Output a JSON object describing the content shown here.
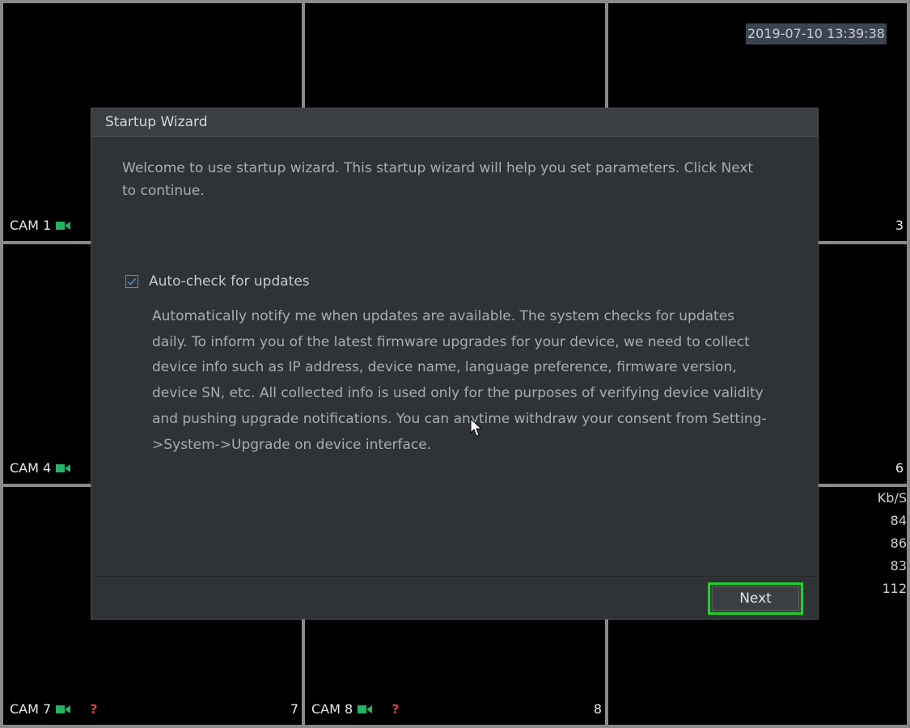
{
  "overlay": {
    "timestamp": "2019-07-10 13:39:38",
    "bitrate_header": "Kb/S",
    "bitrates": [
      "84",
      "86",
      "83",
      "112"
    ]
  },
  "cameras": {
    "cam1": {
      "label": "CAM 1"
    },
    "cam3": {
      "number": "3"
    },
    "cam4": {
      "label": "CAM 4"
    },
    "cam6": {
      "number": "6"
    },
    "cam7": {
      "label": "CAM 7",
      "number": "7",
      "status_glyph": "?"
    },
    "cam8": {
      "label": "CAM 8",
      "number": "8",
      "status_glyph": "?"
    },
    "icon": "video-camera-icon",
    "icon_color": "#27b366",
    "status_color": "#e53a3a"
  },
  "dialog": {
    "title": "Startup Wizard",
    "intro": "Welcome to use startup wizard. This startup wizard will help you set parameters. Click Next to continue.",
    "auto_check": {
      "label": "Auto-check for updates",
      "checked": true
    },
    "description": "Automatically notify me when updates are available. The system checks for updates daily. To inform you of the latest firmware upgrades for your device, we need to collect device info such as IP address, device name, language preference, firmware version, device SN, etc. All collected info is used only for the purposes of verifying device validity and pushing upgrade notifications. You can anytime withdraw your consent from Setting->System->Upgrade on device interface.",
    "next_label": "Next",
    "highlight_color": "#1fd22a"
  }
}
